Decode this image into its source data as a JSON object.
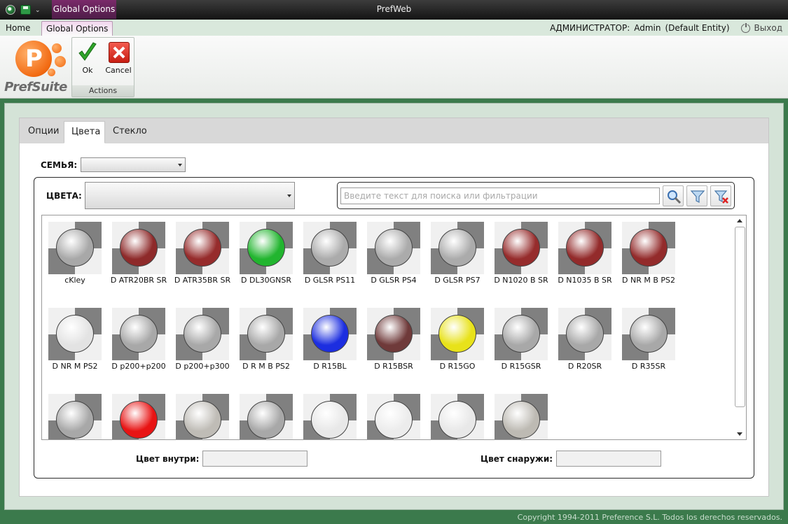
{
  "window": {
    "title": "PrefWeb",
    "context_tab": "Global Options"
  },
  "ribbon_tabs": [
    {
      "label": "Home"
    },
    {
      "label": "Global Options"
    }
  ],
  "user": {
    "role": "АДМИНИСТРАТОР:",
    "name": "Admin",
    "entity": "(Default Entity)",
    "logout": "Выход"
  },
  "logo": {
    "text": "PrefSuite"
  },
  "actions": {
    "ok_label": "Ok",
    "cancel_label": "Cancel",
    "group_caption": "Actions"
  },
  "panel_tabs": [
    {
      "label": "Опции"
    },
    {
      "label": "Цвета"
    },
    {
      "label": "Стекло"
    }
  ],
  "active_tab": "Цвета",
  "family": {
    "label": "СЕМЬЯ:",
    "value": ""
  },
  "colors": {
    "label": "ЦВЕТА:",
    "value": ""
  },
  "search": {
    "placeholder": "Введите текст для поиска или фильтрации",
    "value": ""
  },
  "swatches": [
    {
      "name": "cKley",
      "color": "#a8a8a8"
    },
    {
      "name": "D ATR20BR SR",
      "color": "#8e2a2a"
    },
    {
      "name": "D ATR35BR SR",
      "color": "#962c2c"
    },
    {
      "name": "D DL30GNSR",
      "color": "#22b52f"
    },
    {
      "name": "D GLSR PS11",
      "color": "#ababab"
    },
    {
      "name": "D GLSR PS4",
      "color": "#ababab"
    },
    {
      "name": "D GLSR PS7",
      "color": "#ababab"
    },
    {
      "name": "D N1020 B SR",
      "color": "#962c2c"
    },
    {
      "name": "D N1035 B SR",
      "color": "#932b2b"
    },
    {
      "name": "D NR M B PS2",
      "color": "#932b2b"
    },
    {
      "name": "D NR M PS2",
      "color": "#e3e3e3"
    },
    {
      "name": "D p200+p200",
      "color": "#a8a8a8"
    },
    {
      "name": "D p200+p300",
      "color": "#a8a8a8"
    },
    {
      "name": "D R M B PS2",
      "color": "#a8a8a8"
    },
    {
      "name": "D R15BL",
      "color": "#1c2ee0"
    },
    {
      "name": "D R15BSR",
      "color": "#6f3a3a"
    },
    {
      "name": "D R15GO",
      "color": "#e8e21a"
    },
    {
      "name": "D R15GSR",
      "color": "#a8a8a8"
    },
    {
      "name": "D R20SR",
      "color": "#a8a8a8"
    },
    {
      "name": "D R35SR",
      "color": "#a8a8a8"
    },
    {
      "name": "",
      "color": "#a8a8a8"
    },
    {
      "name": "",
      "color": "#e81414"
    },
    {
      "name": "",
      "color": "#bfbcb6"
    },
    {
      "name": "",
      "color": "#a8a8a8"
    },
    {
      "name": "",
      "color": "#e8e8e8"
    },
    {
      "name": "",
      "color": "#ececec"
    },
    {
      "name": "",
      "color": "#e8e8e8"
    },
    {
      "name": "",
      "color": "#bdbab3"
    }
  ],
  "inside_color": {
    "label": "Цвет внутри:",
    "value": ""
  },
  "outside_color": {
    "label": "Цвет снаружи:",
    "value": ""
  },
  "status": {
    "copyright": "Copyright 1994-2011 Preference S.L. Todos los derechos reservados."
  }
}
